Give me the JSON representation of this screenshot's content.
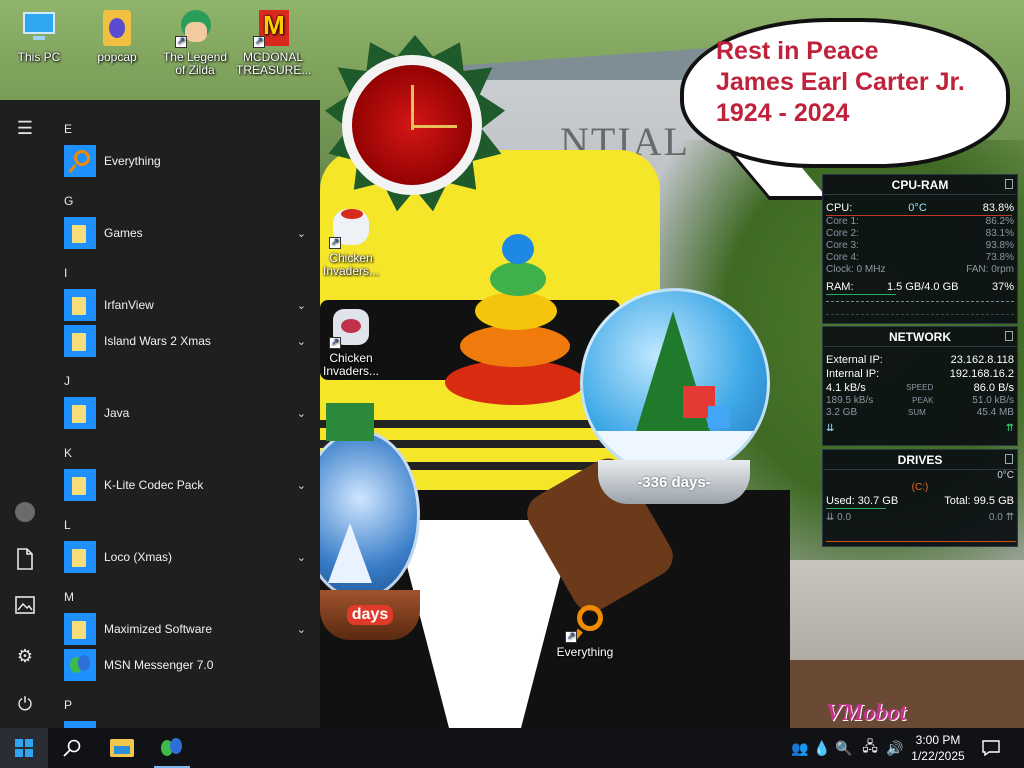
{
  "desktop": {
    "icons": [
      {
        "label": "This PC",
        "icon": "computer-icon"
      },
      {
        "label": "popcap",
        "icon": "folder-icon"
      },
      {
        "label": "The Legend of Zilda",
        "icon": "game-icon"
      },
      {
        "label": "MCDONAL TREASURE...",
        "icon": "mcdonalds-icon"
      },
      {
        "label": "Chicken Invaders...",
        "icon": "chicken-icon"
      },
      {
        "label": "Chicken Invaders...",
        "icon": "chicken-icon"
      },
      {
        "label": "Everything",
        "icon": "search-icon"
      }
    ],
    "bubble": [
      "Rest in Peace",
      "James Earl Carter Jr.",
      "1924 - 2024"
    ],
    "wall_text": "NTIAL",
    "globe_days": "-336 days-",
    "globe_small_days": "days",
    "watermark": "VMobot"
  },
  "cpu_ram": {
    "title": "CPU-RAM",
    "cpu_label": "CPU:",
    "cpu_temp": "0°C",
    "cpu_pct": "83.8%",
    "cores": [
      {
        "label": "Core 1:",
        "pct": "86.2%"
      },
      {
        "label": "Core 2:",
        "pct": "83.1%"
      },
      {
        "label": "Core 3:",
        "pct": "93.8%"
      },
      {
        "label": "Core 4:",
        "pct": "73.8%"
      }
    ],
    "clock": "Clock: 0 MHz",
    "fan": "FAN: 0rpm",
    "ram_label": "RAM:",
    "ram_used": "1.5 GB/4.0 GB",
    "ram_pct": "37%"
  },
  "network": {
    "title": "NETWORK",
    "external_label": "External IP:",
    "external_ip": "23.162.8.118",
    "internal_label": "Internal IP:",
    "internal_ip": "192.168.16.2",
    "speed_down": "4.1 kB/s",
    "speed_label": "SPEED",
    "speed_up": "86.0 B/s",
    "peak_down": "189.5 kB/s",
    "peak_label": "PEAK",
    "peak_up": "51.0 kB/s",
    "sum_down": "3.2 GB",
    "sum_label": "SUM",
    "sum_up": "45.4 MB"
  },
  "drives": {
    "title": "DRIVES",
    "temp": "0°C",
    "letter": "(C:)",
    "used": "Used: 30.7 GB",
    "total": "Total: 99.5 GB",
    "read": "0.0",
    "write": "0.0"
  },
  "start_menu": {
    "groups": [
      {
        "letter": "E",
        "apps": [
          {
            "name": "Everything",
            "expand": false
          }
        ]
      },
      {
        "letter": "G",
        "apps": [
          {
            "name": "Games",
            "expand": true
          }
        ]
      },
      {
        "letter": "I",
        "apps": [
          {
            "name": "IrfanView",
            "expand": true
          },
          {
            "name": "Island Wars 2 Xmas",
            "expand": true
          }
        ]
      },
      {
        "letter": "J",
        "apps": [
          {
            "name": "Java",
            "expand": true
          }
        ]
      },
      {
        "letter": "K",
        "apps": [
          {
            "name": "K-Lite Codec Pack",
            "expand": true
          }
        ]
      },
      {
        "letter": "L",
        "apps": [
          {
            "name": "Loco (Xmas)",
            "expand": true
          }
        ]
      },
      {
        "letter": "M",
        "apps": [
          {
            "name": "Maximized Software",
            "expand": true
          },
          {
            "name": "MSN Messenger 7.0",
            "expand": false
          }
        ]
      },
      {
        "letter": "P",
        "apps": []
      }
    ]
  },
  "taskbar": {
    "time": "3:00 PM",
    "date": "1/22/2025"
  }
}
